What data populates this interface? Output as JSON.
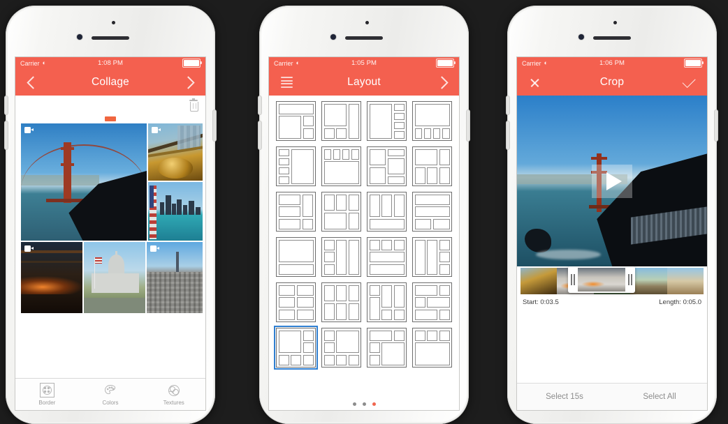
{
  "theme": {
    "accent": "#f4604f",
    "selected_outline": "#2f7fd1",
    "active_dot": "#f0664f"
  },
  "phones": [
    {
      "name": "collage",
      "status": {
        "carrier": "Carrier",
        "wifi_icon": "wifi-icon",
        "time": "1:08 PM",
        "battery_icon": "battery-icon"
      },
      "nav": {
        "back_icon": "chevron-left-icon",
        "title": "Collage",
        "forward_icon": "chevron-right-icon"
      },
      "toolbar": {
        "delete_icon": "trash-icon",
        "drag_handle": "collage-drag-handle"
      },
      "cells": [
        {
          "name": "golden-gate-bridge",
          "badge": "video-badge"
        },
        {
          "name": "golden-ornament",
          "badge": "video-badge"
        },
        {
          "name": "city-skyline-waterfront",
          "badge": ""
        },
        {
          "name": "night-highway-lights",
          "badge": "video-badge"
        },
        {
          "name": "city-hall-flags",
          "badge": ""
        },
        {
          "name": "san-francisco-rooftops",
          "badge": "video-badge"
        }
      ],
      "tabs": [
        {
          "label": "Border",
          "icon": "border-icon"
        },
        {
          "label": "Colors",
          "icon": "palette-icon"
        },
        {
          "label": "Textures",
          "icon": "textures-icon"
        }
      ]
    },
    {
      "name": "layout",
      "status": {
        "carrier": "Carrier",
        "wifi_icon": "wifi-icon",
        "time": "1:05 PM",
        "battery_icon": "battery-icon"
      },
      "nav": {
        "menu_icon": "hamburger-icon",
        "title": "Layout",
        "forward_icon": "chevron-right-icon"
      },
      "selected_index": 20,
      "layouts": [
        {
          "id": 1,
          "cols": "1fr 1fr 1fr",
          "rows": "1fr 1fr 1fr",
          "areas": [
            "a a a",
            "b b c",
            "b b d"
          ]
        },
        {
          "id": 2,
          "cols": "1fr 1fr 1fr",
          "rows": "1fr 1fr 1fr",
          "areas": [
            "a a c",
            "a a c",
            "b d c"
          ]
        },
        {
          "id": 3,
          "cols": "1fr 1fr 1fr",
          "rows": "1fr 1fr 1fr 1fr",
          "areas": [
            "a a b",
            "a a c",
            "a a d",
            "a a e"
          ]
        },
        {
          "id": 4,
          "cols": "1fr 1fr 1fr 1fr",
          "rows": "1fr 1fr 1fr",
          "areas": [
            "a a a a",
            "a a a a",
            "b c d e"
          ]
        },
        {
          "id": 5,
          "cols": "1fr 2fr",
          "rows": "1fr 1fr 1fr 1fr",
          "areas": [
            "a e",
            "b e",
            "c e",
            "d e"
          ]
        },
        {
          "id": 6,
          "cols": "1fr 1fr 1fr 1fr",
          "rows": "1fr 1fr 1fr",
          "areas": [
            "a b c d",
            "e e e e",
            "e e e e"
          ]
        },
        {
          "id": 7,
          "cols": "1fr 1fr",
          "rows": "1fr 1fr 1fr 1fr",
          "areas": [
            "a c",
            "a d",
            "b d",
            "b e"
          ]
        },
        {
          "id": 8,
          "cols": "1fr 1fr 1fr",
          "rows": "1fr 1fr",
          "areas": [
            "a a b",
            "c d e"
          ]
        },
        {
          "id": 9,
          "cols": "2fr 1fr",
          "rows": "1fr 1fr 1fr",
          "areas": [
            "a d",
            "b d",
            "c e"
          ]
        },
        {
          "id": 10,
          "cols": "1fr 1fr 1fr",
          "rows": "1fr 1fr",
          "areas": [
            "a b c",
            "d d e"
          ]
        },
        {
          "id": 11,
          "cols": "1fr 1fr 1fr",
          "rows": "1fr 1fr 1fr",
          "areas": [
            "a b c",
            "a b c",
            "d d d"
          ]
        },
        {
          "id": 12,
          "cols": "1fr 1fr",
          "rows": "1fr 1fr 1fr",
          "areas": [
            "a a",
            "b b",
            "c d"
          ]
        },
        {
          "id": 13,
          "cols": "1fr 1fr 1fr",
          "rows": "1fr 1fr 1fr",
          "areas": [
            "a a a",
            "a a a",
            "b b b"
          ]
        },
        {
          "id": 14,
          "cols": "1fr 1fr 1fr",
          "rows": "1fr 1fr 1fr",
          "areas": [
            "a d e",
            "b d e",
            "c d e"
          ]
        },
        {
          "id": 15,
          "cols": "1fr 1fr 1fr",
          "rows": "1fr 1fr 1fr",
          "areas": [
            "a b c",
            "d d d",
            "e e e"
          ]
        },
        {
          "id": 16,
          "cols": "1fr 1fr 1fr",
          "rows": "1fr 1fr 1fr",
          "areas": [
            "a b c",
            "a b d",
            "a b e"
          ]
        },
        {
          "id": 17,
          "cols": "1fr 1fr",
          "rows": "1fr 1fr 1fr",
          "areas": [
            "a b",
            "c d",
            "e f"
          ]
        },
        {
          "id": 18,
          "cols": "1fr 1fr 1fr",
          "rows": "1fr 1fr",
          "areas": [
            "a b c",
            "d e f"
          ]
        },
        {
          "id": 19,
          "cols": "1fr 1fr 1fr",
          "rows": "1fr 1fr 1fr",
          "areas": [
            "a b c",
            "d b c",
            "d e f"
          ]
        },
        {
          "id": 20,
          "cols": "1fr 1fr 1fr",
          "rows": "1fr 1fr 1fr",
          "areas": [
            "a a b",
            "c d d",
            "e e f"
          ]
        },
        {
          "id": 21,
          "cols": "1fr 1fr 1fr",
          "rows": "1fr 1fr 1fr",
          "areas": [
            "a a b",
            "a a c",
            "d e f"
          ]
        },
        {
          "id": 22,
          "cols": "1fr 1fr 1fr",
          "rows": "1fr 1fr 1fr",
          "areas": [
            "a b b",
            "c b b",
            "d e f"
          ]
        },
        {
          "id": 23,
          "cols": "1fr 1fr 1fr",
          "rows": "1fr 1fr 1fr",
          "areas": [
            "a a b",
            "c d d",
            "e d d"
          ]
        },
        {
          "id": 24,
          "cols": "1fr 1fr 1fr",
          "rows": "1fr 1fr 1fr",
          "areas": [
            "a b c",
            "d d d",
            "d d d"
          ]
        }
      ],
      "page_dots": {
        "count": 3,
        "active": 2
      }
    },
    {
      "name": "crop",
      "status": {
        "carrier": "Carrier",
        "wifi_icon": "wifi-icon",
        "time": "1:06 PM",
        "battery_icon": "battery-icon"
      },
      "nav": {
        "cancel_icon": "close-icon",
        "title": "Crop",
        "confirm_icon": "checkmark-icon"
      },
      "player": {
        "play_icon": "play-icon",
        "poster": "golden-gate-bridge-video"
      },
      "trim": {
        "start_label": "Start: 0:03.5",
        "length_label": "Length: 0:05.0"
      },
      "actions": [
        {
          "label": "Select 15s"
        },
        {
          "label": "Select All"
        }
      ]
    }
  ]
}
